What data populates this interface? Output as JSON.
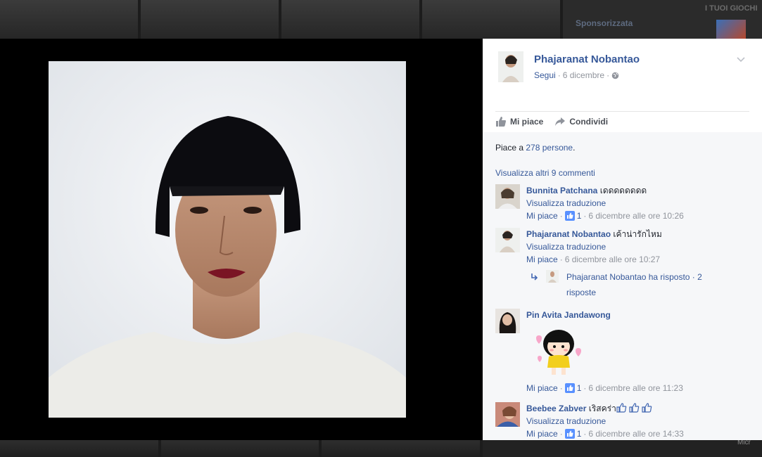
{
  "background": {
    "sponsored_label": "Sponsorizzata",
    "games_label": "I TUOI GIOCHI",
    "bottom_right_text": "Micr"
  },
  "post": {
    "author": "Phajaranat Nobantao",
    "follow_label": "Segui",
    "date": "6 dicembre",
    "actions": {
      "like_label": "Mi piace",
      "share_label": "Condividi"
    },
    "likes_prefix": "Piace a",
    "likes_link": "278 persone",
    "likes_suffix": ".",
    "view_more_comments": "Visualizza altri 9 commenti"
  },
  "comments": [
    {
      "author": "Bunnita Patchana",
      "text": "เดดดดดดดด",
      "translate": "Visualizza traduzione",
      "like_label": "Mi piace",
      "like_count": "1",
      "time": "6 dicembre alle ore 10:26"
    },
    {
      "author": "Phajaranat Nobantao",
      "text": "เค้าน่ารักไหม",
      "translate": "Visualizza traduzione",
      "like_label": "Mi piace",
      "time": "6 dicembre alle ore 10:27",
      "reply_text": "Phajaranat Nobantao ha risposto · 2 risposte"
    },
    {
      "author": "Pin Avita Jandawong",
      "like_label": "Mi piace",
      "like_count": "1",
      "time": "6 dicembre alle ore 11:23"
    },
    {
      "author": "Beebee Zabver",
      "text": "เริสคร่า",
      "translate": "Visualizza traduzione",
      "like_label": "Mi piace",
      "like_count": "1",
      "time": "6 dicembre alle ore 14:33"
    }
  ],
  "colors": {
    "link": "#365899",
    "meta": "#90949c",
    "panel_bg": "#f6f7f9",
    "stage_bg": "#000000"
  }
}
